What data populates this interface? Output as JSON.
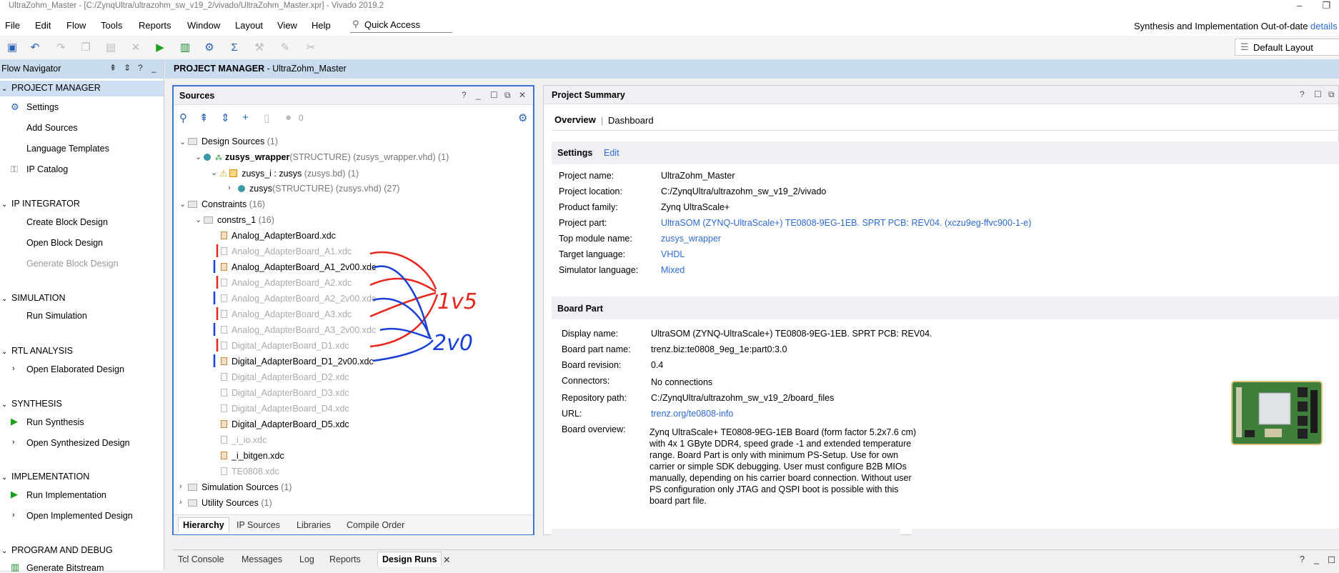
{
  "window": {
    "title": "UltraZohm_Master - [C:/ZynqUltra/ultrazohm_sw_v19_2/vivado/UltraZohm_Master.xpr] - Vivado 2019.2"
  },
  "menu": {
    "items": [
      "File",
      "Edit",
      "Flow",
      "Tools",
      "Reports",
      "Window",
      "Layout",
      "View",
      "Help"
    ],
    "quick_access": "Quick Access",
    "status": "Synthesis and Implementation Out-of-date",
    "details": "details",
    "layout": "Default Layout"
  },
  "flow_nav": {
    "title": "Flow Navigator",
    "sections": {
      "project_manager": {
        "label": "PROJECT MANAGER",
        "items": [
          "Settings",
          "Add Sources",
          "Language Templates",
          "IP Catalog"
        ]
      },
      "ip_integrator": {
        "label": "IP INTEGRATOR",
        "items": [
          "Create Block Design",
          "Open Block Design",
          "Generate Block Design"
        ]
      },
      "simulation": {
        "label": "SIMULATION",
        "items": [
          "Run Simulation"
        ]
      },
      "rtl": {
        "label": "RTL ANALYSIS",
        "items": [
          "Open Elaborated Design"
        ]
      },
      "synthesis": {
        "label": "SYNTHESIS",
        "items": [
          "Run Synthesis",
          "Open Synthesized Design"
        ]
      },
      "implementation": {
        "label": "IMPLEMENTATION",
        "items": [
          "Run Implementation",
          "Open Implemented Design"
        ]
      },
      "program": {
        "label": "PROGRAM AND DEBUG",
        "items": [
          "Generate Bitstream"
        ]
      }
    }
  },
  "main": {
    "header_bold": "PROJECT MANAGER",
    "header_rest": " - UltraZohm_Master"
  },
  "sources": {
    "title": "Sources",
    "count": "0",
    "tree": {
      "design_sources": "Design Sources",
      "design_sources_count": "(1)",
      "zusys_wrapper": "zusys_wrapper",
      "zusys_wrapper_sub": "(STRUCTURE) (zusys_wrapper.vhd) (1)",
      "zusys_i": "zusys_i : zusys",
      "zusys_i_sub": "(zusys.bd) (1)",
      "zusys": "zusys",
      "zusys_sub": "(STRUCTURE) (zusys.vhd) (27)",
      "constraints": "Constraints",
      "constraints_count": "(16)",
      "constrs_1": "constrs_1",
      "constrs_1_count": "(16)",
      "files": [
        "Analog_AdapterBoard.xdc",
        "Analog_AdapterBoard_A1.xdc",
        "Analog_AdapterBoard_A1_2v00.xdc",
        "Analog_AdapterBoard_A2.xdc",
        "Analog_AdapterBoard_A2_2v00.xdc",
        "Analog_AdapterBoard_A3.xdc",
        "Analog_AdapterBoard_A3_2v00.xdc",
        "Digital_AdapterBoard_D1.xdc",
        "Digital_AdapterBoard_D1_2v00.xdc",
        "Digital_AdapterBoard_D2.xdc",
        "Digital_AdapterBoard_D3.xdc",
        "Digital_AdapterBoard_D4.xdc",
        "Digital_AdapterBoard_D5.xdc",
        "_i_io.xdc",
        "_i_bitgen.xdc",
        "TE0808.xdc"
      ],
      "simulation_sources": "Simulation Sources",
      "simulation_sources_count": "(1)",
      "utility_sources": "Utility Sources",
      "utility_sources_count": "(1)"
    },
    "tabs": [
      "Hierarchy",
      "IP Sources",
      "Libraries",
      "Compile Order"
    ],
    "annotations": {
      "v15": "1v5",
      "v20": "2v0"
    }
  },
  "summary": {
    "title": "Project Summary",
    "tabs": [
      "Overview",
      "Dashboard"
    ],
    "settings": {
      "label": "Settings",
      "edit": "Edit",
      "rows": [
        {
          "k": "Project name:",
          "v": "UltraZohm_Master"
        },
        {
          "k": "Project location:",
          "v": "C:/ZynqUltra/ultrazohm_sw_v19_2/vivado"
        },
        {
          "k": "Product family:",
          "v": "Zynq UltraScale+"
        },
        {
          "k": "Project part:",
          "v": "UltraSOM (ZYNQ-UltraScale+) TE0808-9EG-1EB. SPRT PCB: REV04. (xczu9eg-ffvc900-1-e)"
        },
        {
          "k": "Top module name:",
          "v": "zusys_wrapper"
        },
        {
          "k": "Target language:",
          "v": "VHDL"
        },
        {
          "k": "Simulator language:",
          "v": "Mixed"
        }
      ]
    },
    "board": {
      "label": "Board Part",
      "rows": [
        {
          "k": "Display name:",
          "v": "UltraSOM (ZYNQ-UltraScale+) TE0808-9EG-1EB. SPRT PCB: REV04."
        },
        {
          "k": "Board part name:",
          "v": "trenz.biz:te0808_9eg_1e:part0:3.0"
        },
        {
          "k": "Board revision:",
          "v": "0.4"
        },
        {
          "k": "Connectors:",
          "v": "No connections"
        },
        {
          "k": "Repository path:",
          "v": "C:/ZynqUltra/ultrazohm_sw_v19_2/board_files"
        },
        {
          "k": "URL:",
          "v": "trenz.org/te0808-info"
        },
        {
          "k": "Board overview:",
          "v": ""
        }
      ],
      "overview": "Zynq UltraScale+ TE0808-9EG-1EB Board (form factor 5.2x7.6 cm) with 4x 1 GByte DDR4, speed grade -1 and extended temperature range. Board Part is only with minimum PS-Setup. Use for own carrier or simple SDK debugging. User must configure B2B MIOs manually, depending on his carrier board connection. Without user PS configuration only JTAG and QSPI boot is possible with this board part file."
    }
  },
  "bottom_tabs": [
    "Tcl Console",
    "Messages",
    "Log",
    "Reports",
    "Design Runs"
  ],
  "colors": {
    "accent": "#3c76d2",
    "link": "#2d6bd4",
    "header": "#c9dbee",
    "red_ink": "#e8261e",
    "blue_ink": "#1a3fd6"
  }
}
